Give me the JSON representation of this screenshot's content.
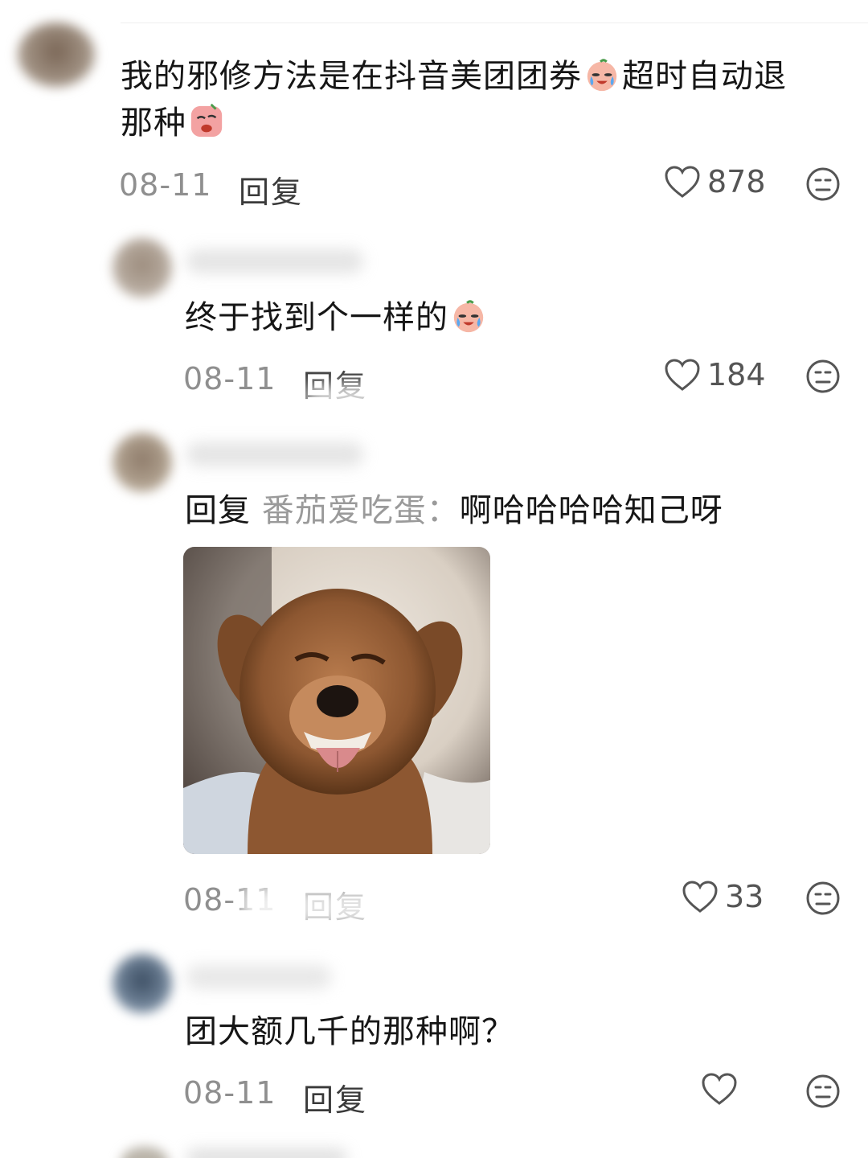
{
  "comments": [
    {
      "text_a": "我的邪修方法是在抖音美团团券",
      "text_b": "超时自动退",
      "text_c": "那种",
      "date": "08-11",
      "reply_label": "回复",
      "likes": "878"
    },
    {
      "text_a": "终于找到个一样的",
      "date": "08-11",
      "reply_label": "回复",
      "likes": "184"
    },
    {
      "reply_prefix": "回复",
      "mention": "番茄爱吃蛋：",
      "text_a": "啊哈哈哈哈知己呀",
      "date": "08-11",
      "reply_label": "回复",
      "likes": "33"
    },
    {
      "text_a": "团大额几千的那种啊？",
      "date": "08-11",
      "reply_label": "回复",
      "likes": ""
    }
  ],
  "colors": {
    "text": "#161616",
    "meta": "#8f8f8f",
    "icon": "#555555"
  },
  "icons": {
    "like": "heart-outline-icon",
    "more": "neutral-face-icon",
    "emoji_cry": "crying-face-emoji",
    "emoji_sad": "sad-face-emoji"
  }
}
